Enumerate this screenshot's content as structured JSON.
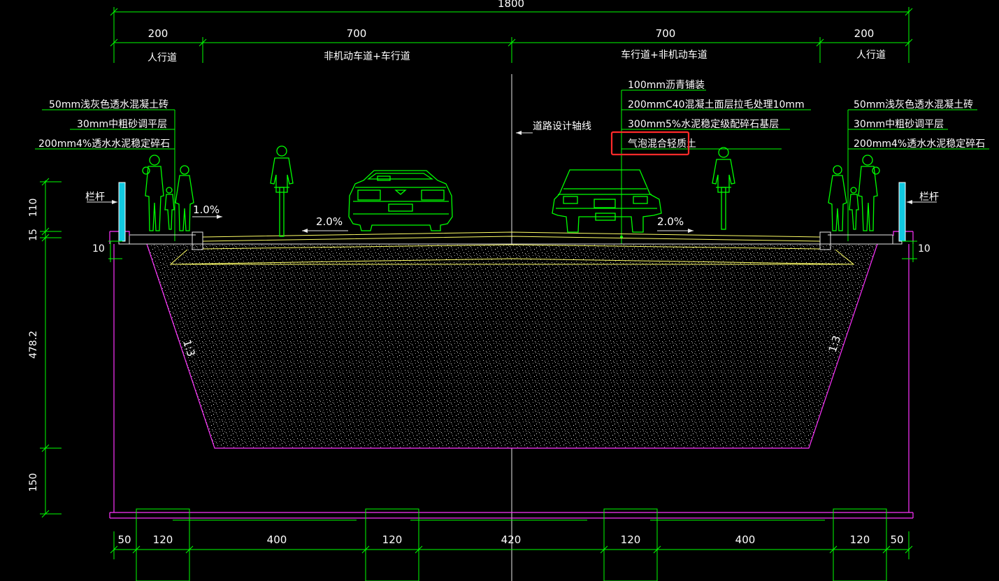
{
  "top_dims": {
    "total": "1800",
    "left_walk": "200",
    "left_lane": "700",
    "right_lane": "700",
    "right_walk": "200"
  },
  "zone_labels": {
    "left_walk": "人行道",
    "left_lane": "非机动车道+车行道",
    "right_lane": "车行道+非机动车道",
    "right_walk": "人行道"
  },
  "left_layers": [
    "50mm浅灰色透水混凝土砖",
    "30mm中粗砂调平层",
    "200mm4%透水水泥稳定碎石"
  ],
  "right_layers": [
    "50mm浅灰色透水混凝土砖",
    "30mm中粗砂调平层",
    "200mm4%透水水泥稳定碎石"
  ],
  "road_layers": [
    "100mm沥青铺装",
    "200mmC40混凝土面层拉毛处理10mm",
    "300mm5%水泥稳定级配碎石基层",
    "气泡混合轻质土"
  ],
  "centerline_label": "道路设计轴线",
  "railing_left": "栏杆",
  "railing_right": "栏杆",
  "slopes": {
    "walk_left": "1.0%",
    "road_left": "2.0%",
    "road_right": "2.0%",
    "embank_left": "1:3",
    "embank_right": "1:3"
  },
  "left_dims": {
    "d110": "110",
    "d15": "15",
    "d10_left": "10",
    "d478": "478.2",
    "d150": "150"
  },
  "right_dims": {
    "d10_right": "10"
  },
  "bottom_dims": [
    "50",
    "120",
    "400",
    "120",
    "420",
    "120",
    "400",
    "120",
    "50"
  ],
  "colors": {
    "dimension": "#00ff00",
    "embankment": "#ff33ff",
    "pavement": "#ffff66",
    "highlight": "#ff2a2a"
  }
}
